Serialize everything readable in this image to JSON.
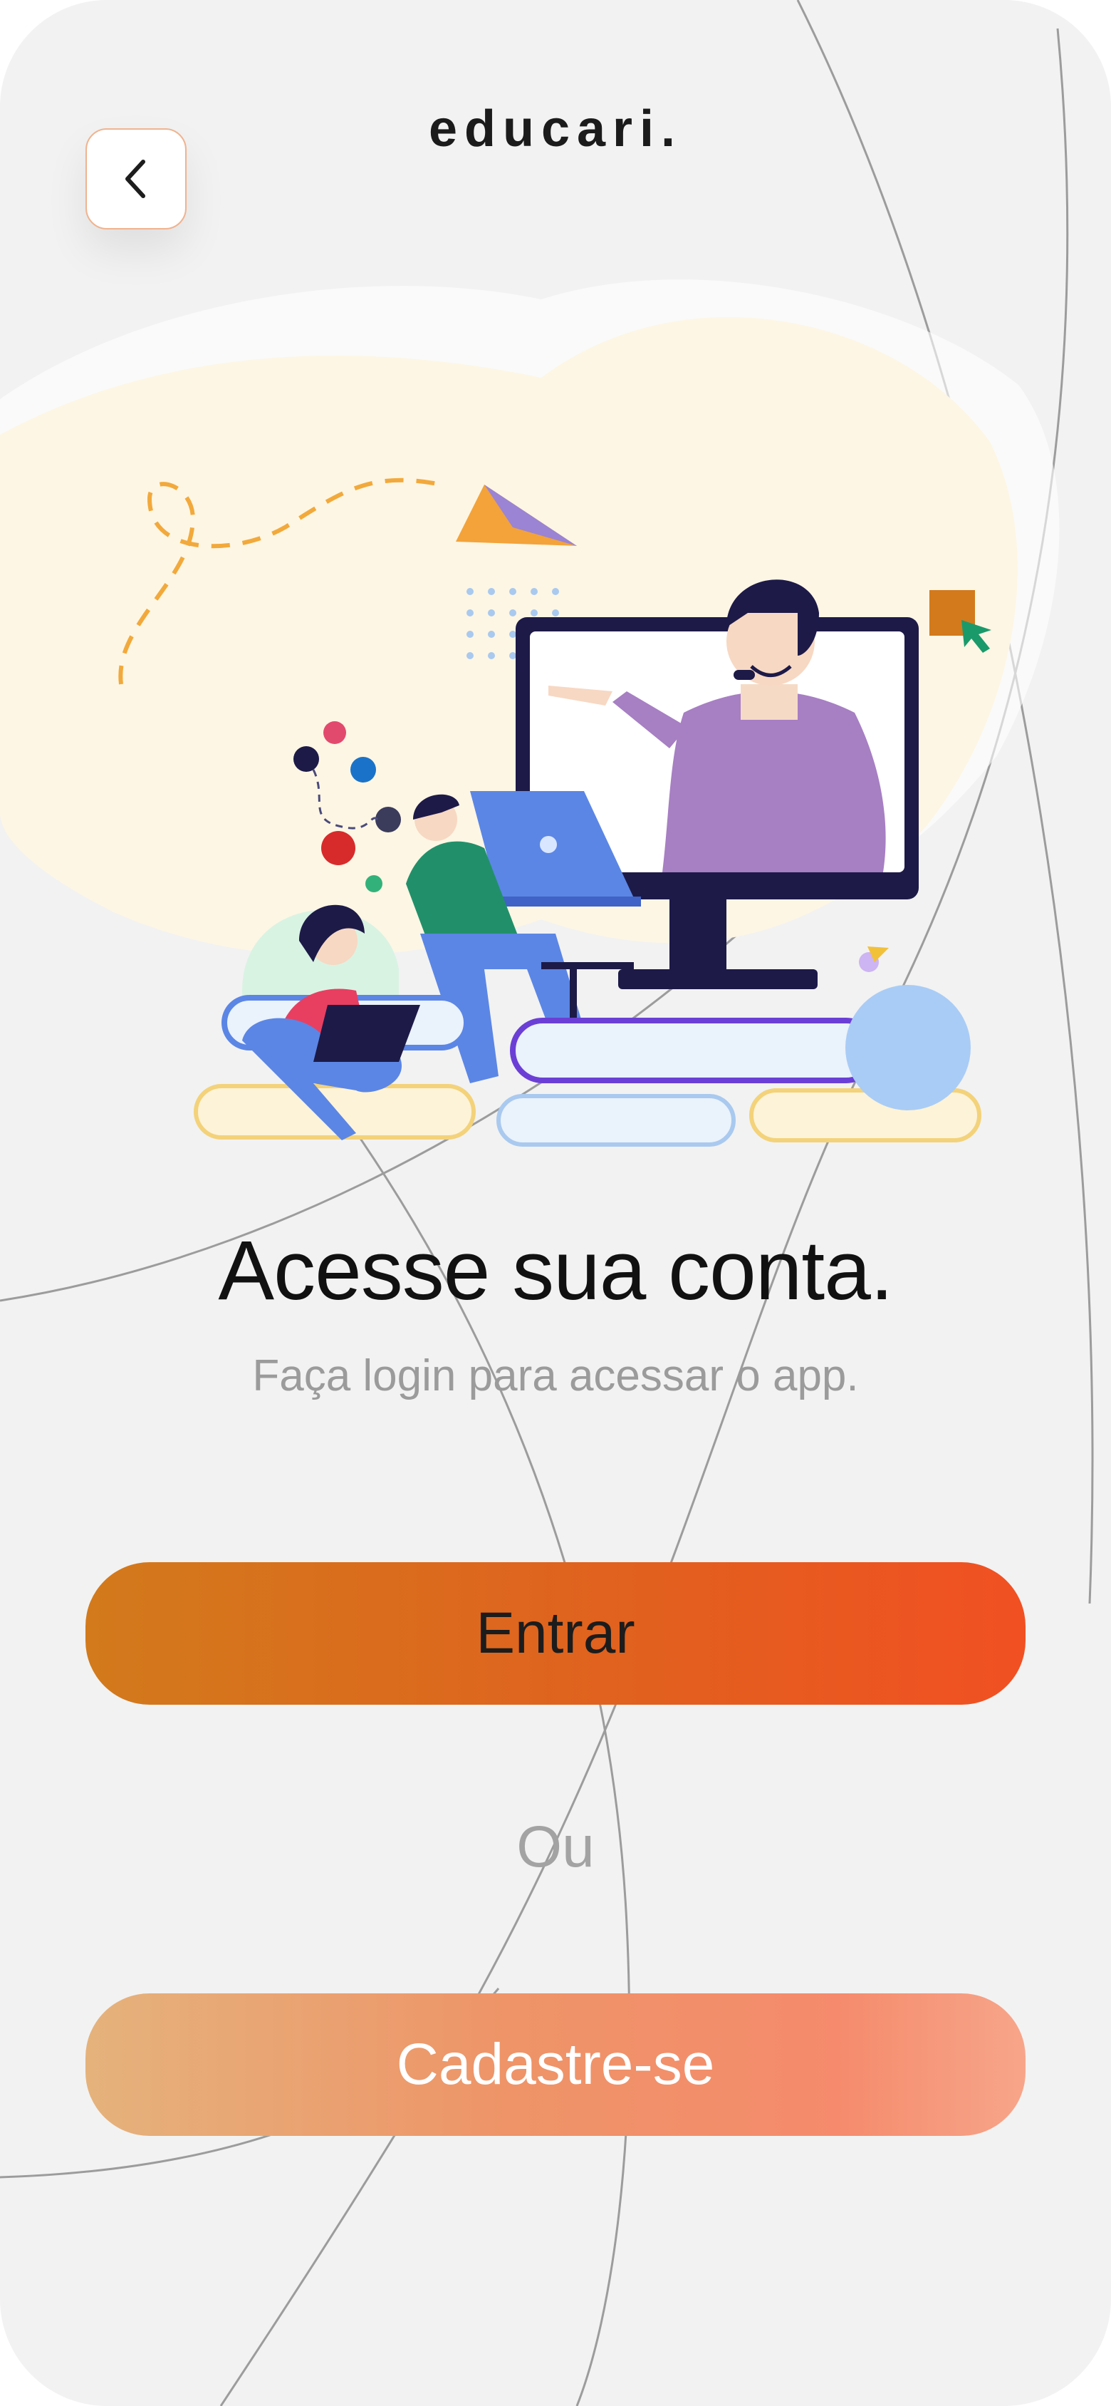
{
  "header": {
    "logo": "educari.",
    "back_button_icon": "chevron-left-icon"
  },
  "hero": {
    "illustration": "online-education-illustration"
  },
  "content": {
    "title": "Acesse sua conta.",
    "subtitle": "Faça login para acessar o app."
  },
  "actions": {
    "login_label": "Entrar",
    "separator": "Ou",
    "signup_label": "Cadastre-se"
  },
  "colors": {
    "background": "#f2f2f2",
    "primary_gradient_start": "#d27a1c",
    "primary_gradient_end": "#f15022",
    "secondary_gradient_start": "#e5b27c",
    "secondary_gradient_end": "#f7a58a",
    "title": "#111111",
    "muted_text": "#9b9b9b"
  }
}
